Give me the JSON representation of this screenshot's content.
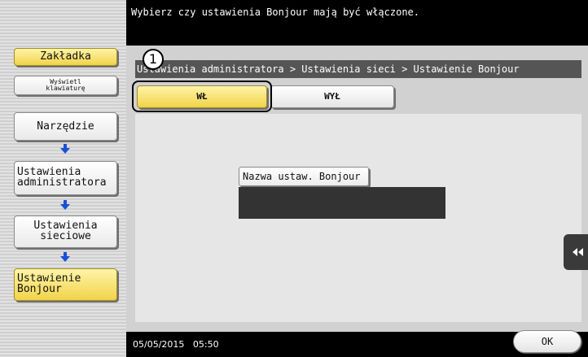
{
  "header": {
    "message": "Wybierz czy ustawienia Bonjour mają być włączone."
  },
  "breadcrumb": {
    "text": "Ustawienia administratora > Ustawienia sieci > Ustawienie Bonjour"
  },
  "sidebar": {
    "bookmark_label": "Zakładka",
    "keyboard_line1": "Wyświetl",
    "keyboard_line2": "klawiaturę",
    "items": [
      {
        "line1": "Narzędzie",
        "line2": ""
      },
      {
        "line1": "Ustawienia",
        "line2": "administratora"
      },
      {
        "line1": "Ustawienia",
        "line2": "sieciowe"
      },
      {
        "line1": "Ustawienie",
        "line2": "Bonjour"
      }
    ]
  },
  "toggle": {
    "on_label": "WŁ",
    "off_label": "WYŁ",
    "selected": "on"
  },
  "callout_number": "1",
  "field": {
    "label": "Nazwa ustaw. Bonjour",
    "value": ""
  },
  "footer": {
    "datetime": "05/05/2015   05:50",
    "ok_label": "OK"
  },
  "colors": {
    "accent_yellow": "#f1d34a",
    "arrow_blue": "#1a4fd6"
  },
  "icons": {
    "side_arrow": "arrow-down-icon",
    "panel_tab": "double-chevron-left-icon"
  }
}
